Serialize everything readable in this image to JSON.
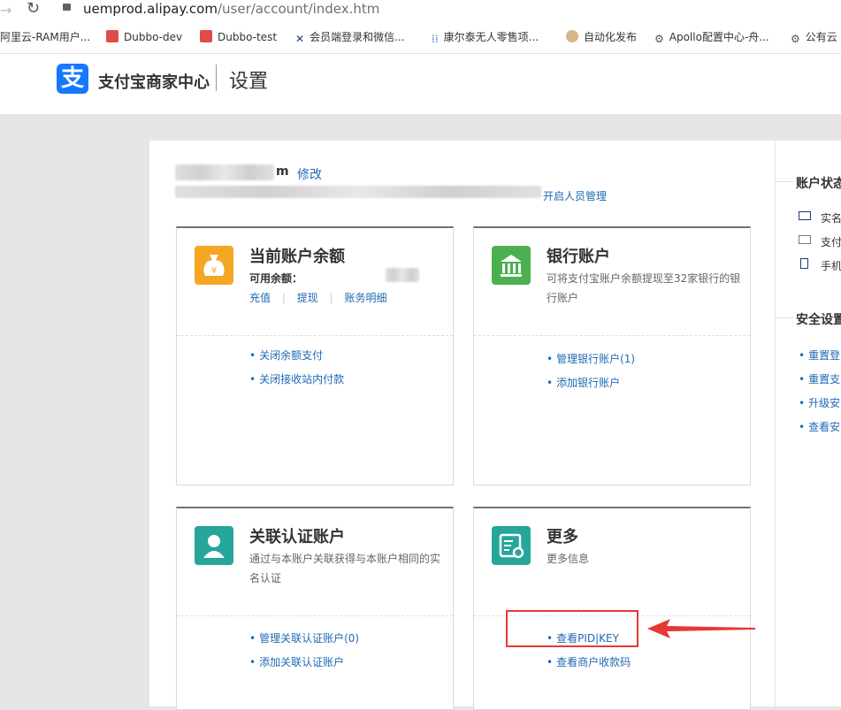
{
  "browser": {
    "url_host": "uemprod.alipay.com",
    "url_path": "/user/account/index.htm",
    "bookmarks": [
      {
        "label": "阿里云-RAM用户...",
        "icon": "cloud-icon"
      },
      {
        "label": "Dubbo-dev",
        "icon": "folder-icon"
      },
      {
        "label": "Dubbo-test",
        "icon": "folder-icon"
      },
      {
        "label": "会员端登录和微信...",
        "icon": "tools-icon"
      },
      {
        "label": "康尔泰无人零售项...",
        "icon": "grid-icon"
      },
      {
        "label": "自动化发布",
        "icon": "avatar-icon"
      },
      {
        "label": "Apollo配置中心-舟...",
        "icon": "hub-icon"
      },
      {
        "label": "公有云",
        "icon": "hub-icon"
      }
    ]
  },
  "header": {
    "logo_glyph": "支",
    "logo_text": "支付宝商家中心",
    "title": "设置"
  },
  "account": {
    "name_suffix": "m",
    "edit_link": "修改",
    "staff_link": "开启人员管理"
  },
  "cards": {
    "balance": {
      "title": "当前账户余额",
      "available_label": "可用余额：",
      "links_inline": [
        "充值",
        "提现",
        "账务明细"
      ],
      "links": [
        "关闭余额支付",
        "关闭接收站内付款"
      ]
    },
    "bank": {
      "title": "银行账户",
      "desc": "可将支付宝账户余额提现至32家银行的银行账户",
      "links": [
        "管理银行账户(1)",
        "添加银行账户"
      ]
    },
    "linked": {
      "title": "关联认证账户",
      "desc": "通过与本账户关联获得与本账户相同的实名认证",
      "links": [
        "管理关联认证账户(0)",
        "添加关联认证账户"
      ]
    },
    "more": {
      "title": "更多",
      "desc": "更多信息",
      "links": [
        "查看PID|KEY",
        "查看商户收款码"
      ]
    }
  },
  "sidebar": {
    "status_title": "账户状态",
    "status_items": [
      "实名",
      "支付",
      "手机"
    ],
    "security_title": "安全设置",
    "security_links": [
      "重置登",
      "重置支",
      "升级安",
      "查看安"
    ]
  },
  "colors": {
    "accent": "#1677ff",
    "link": "#1e69b3",
    "annotation": "#e53935"
  }
}
